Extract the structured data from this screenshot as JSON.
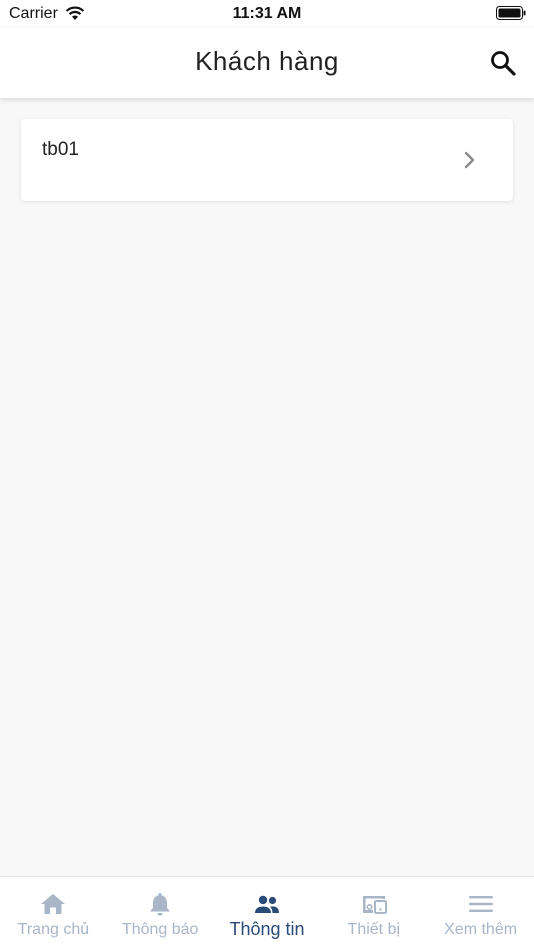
{
  "status_bar": {
    "carrier": "Carrier",
    "time": "11:31 AM"
  },
  "header": {
    "title": "Khách hàng",
    "search_icon": "search-icon"
  },
  "list": {
    "items": [
      {
        "label": "tb01",
        "icon": "chevron-right-icon"
      }
    ]
  },
  "tab_bar": {
    "active_index": 2,
    "active_color": "#2a4a78",
    "inactive_color": "#a9b6c8",
    "tabs": [
      {
        "label": "Trang chủ",
        "icon": "home-icon"
      },
      {
        "label": "Thông báo",
        "icon": "bell-icon"
      },
      {
        "label": "Thông tin",
        "icon": "people-icon"
      },
      {
        "label": "Thiết bị",
        "icon": "devices-icon"
      },
      {
        "label": "Xem thêm",
        "icon": "menu-icon"
      }
    ]
  }
}
